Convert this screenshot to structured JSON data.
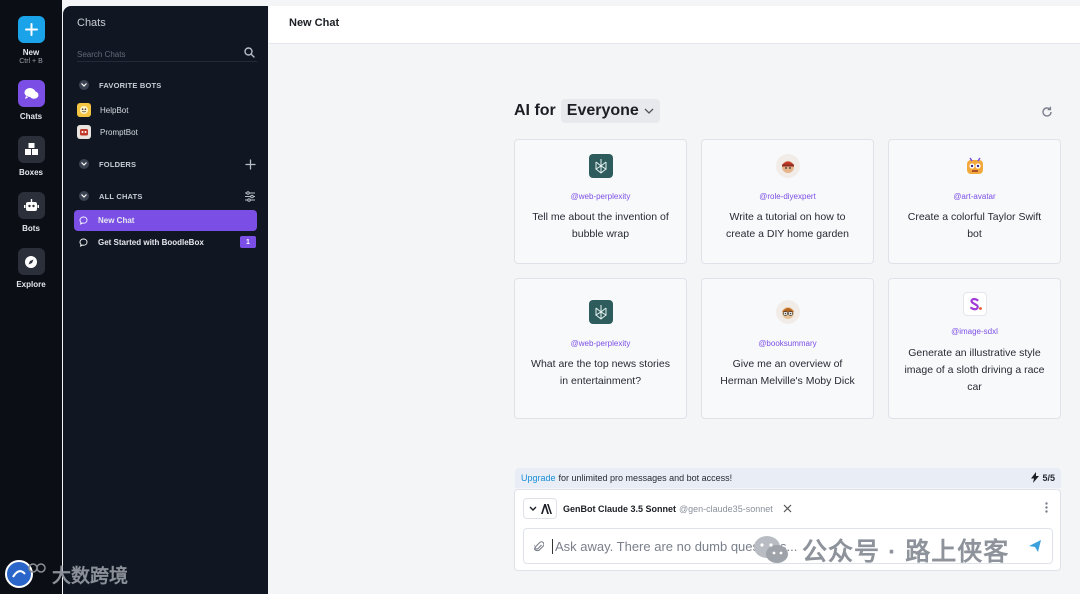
{
  "rail": {
    "new_label": "New",
    "new_shortcut": "Ctrl + B",
    "chats_label": "Chats",
    "boxes_label": "Boxes",
    "bots_label": "Bots",
    "explore_label": "Explore"
  },
  "sidebar": {
    "title": "Chats",
    "search_placeholder": "Search Chats",
    "favorite_bots_label": "FAVORITE BOTS",
    "favorite_bots": [
      {
        "name": "HelpBot",
        "icon": "helpbot-avatar-icon"
      },
      {
        "name": "PromptBot",
        "icon": "promptbot-avatar-icon"
      }
    ],
    "folders_label": "FOLDERS",
    "all_chats_label": "ALL CHATS",
    "chats": [
      {
        "title": "New Chat",
        "active": true
      },
      {
        "title": "Get Started with BoodleBox",
        "badge": "1"
      }
    ]
  },
  "header": {
    "title": "New Chat"
  },
  "main": {
    "ai_for": "AI for",
    "audience": "Everyone",
    "cards": [
      {
        "handle": "@web-perplexity",
        "prompt": "Tell me about the invention of bubble wrap",
        "icon": "perplexity-icon"
      },
      {
        "handle": "@role-diyexpert",
        "prompt": "Write a tutorial on how to create a DIY home garden",
        "icon": "diyexpert-avatar-icon"
      },
      {
        "handle": "@art-avatar",
        "prompt": "Create a colorful Taylor Swift bot",
        "icon": "art-avatar-icon"
      },
      {
        "handle": "@web-perplexity",
        "prompt": "What are the top news stories in entertainment?",
        "icon": "perplexity-icon"
      },
      {
        "handle": "@booksummary",
        "prompt": "Give me an overview of Herman Melville's Moby Dick",
        "icon": "booksummary-avatar-icon"
      },
      {
        "handle": "@image-sdxl",
        "prompt": "Generate an illustrative style image of a sloth driving a race car",
        "icon": "sdxl-icon"
      }
    ]
  },
  "composer": {
    "upgrade_link": "Upgrade",
    "upgrade_text": "for unlimited pro messages and bot access!",
    "quota": "5/5",
    "bot_name": "GenBot Claude 3.5 Sonnet",
    "bot_handle": "@gen-claude35-sonnet",
    "input_placeholder": "Ask away. There are no dumb questions..."
  },
  "watermarks": {
    "left": "大数跨境",
    "right": "公众号 · 路上侠客"
  },
  "colors": {
    "accent": "#7b4fe6",
    "new_button": "#1aa3e8",
    "link": "#1a8fd6",
    "sidebar_bg": "#111722",
    "rail_bg": "#0b0e14"
  }
}
